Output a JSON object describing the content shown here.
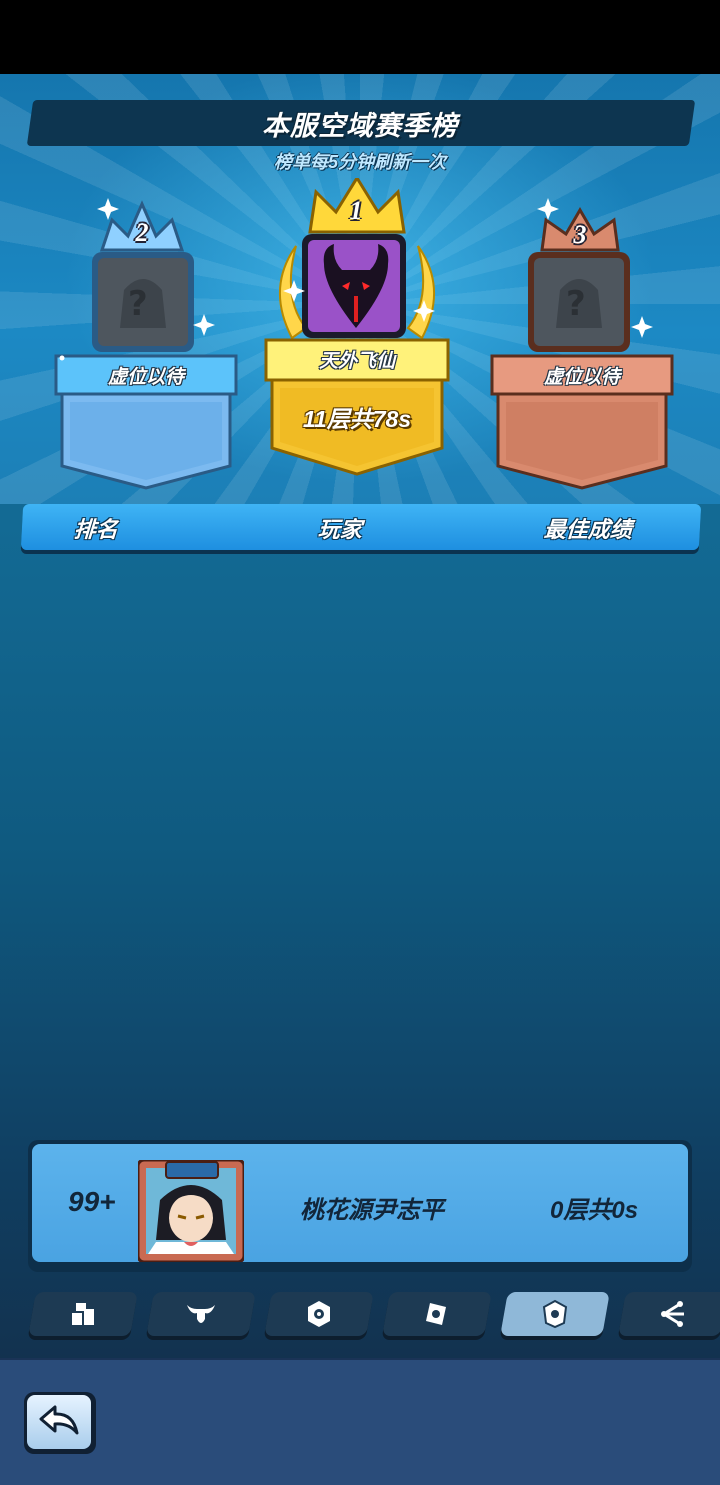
{
  "header": {
    "title": "本服空域赛季榜",
    "subtitle": "榜单每5分钟刷新一次"
  },
  "podium": [
    {
      "rank": "2",
      "name": "虚位以待",
      "score": "",
      "color": "#7cc4f7",
      "avatar_icon": "question-mark-silhouette"
    },
    {
      "rank": "1",
      "name": "天外飞仙",
      "score": "11层共78s",
      "color": "#ffd83a",
      "avatar_icon": "horned-demon"
    },
    {
      "rank": "3",
      "name": "虚位以待",
      "score": "",
      "color": "#d98a6e",
      "avatar_icon": "question-mark-silhouette"
    }
  ],
  "table_header": {
    "rank": "排名",
    "player": "玩家",
    "best": "最佳成绩"
  },
  "my_entry": {
    "rank": "99+",
    "name": "桃花源尹志平",
    "score": "0层共0s",
    "avatar_icon": "character-portrait"
  },
  "tabs": [
    {
      "icon": "blocks-icon",
      "active": false
    },
    {
      "icon": "bull-horns-icon",
      "active": false
    },
    {
      "icon": "shield-icon",
      "active": false
    },
    {
      "icon": "card-icon",
      "active": false
    },
    {
      "icon": "card-icon",
      "active": true
    },
    {
      "icon": "nodes-icon",
      "active": false
    }
  ],
  "footer": {
    "back_icon": "back-arrow-icon"
  }
}
